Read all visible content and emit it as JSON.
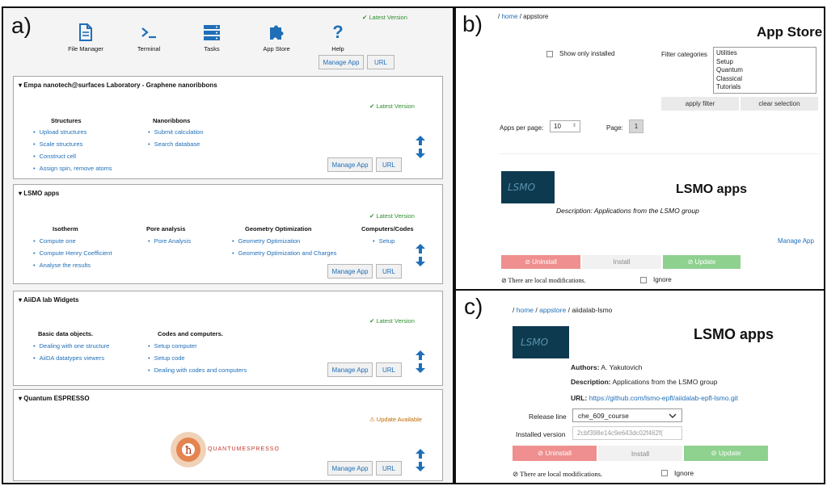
{
  "panel_a": {
    "label": "a)",
    "nav": [
      "File Manager",
      "Terminal",
      "Tasks",
      "App Store",
      "Help"
    ],
    "top_status": "✔ Latest Version",
    "top_buttons": [
      "Manage App",
      "URL"
    ],
    "apps": [
      {
        "title": "▾ Empa nanotech@surfaces Laboratory - Graphene nanoribbons",
        "status": "✔ Latest Version",
        "columns": [
          {
            "heading": "Structures",
            "items": [
              "Upload structures",
              "Scale structures",
              "Construct cell",
              "Assign spin, remove atoms"
            ]
          },
          {
            "heading": "Nanoribbons",
            "items": [
              "Submit calculation",
              "Search database"
            ]
          }
        ],
        "buttons": [
          "Manage App",
          "URL"
        ]
      },
      {
        "title": "▾ LSMO apps",
        "status": "✔ Latest Version",
        "columns": [
          {
            "heading": "Isotherm",
            "items": [
              "Compute one",
              "Compute Henry Coefficient",
              "Analyse the results"
            ]
          },
          {
            "heading": "Pore analysis",
            "items": [
              "Pore Analysis"
            ]
          },
          {
            "heading": "Geometry Optimization",
            "items": [
              "Geometry Optimization",
              "Geometry Optimization and Charges"
            ]
          },
          {
            "heading": "Computers/Codes",
            "items": [
              "Setup"
            ]
          }
        ],
        "buttons": [
          "Manage App",
          "URL"
        ]
      },
      {
        "title": "▾ AiiDA lab Widgets",
        "status": "✔ Latest Version",
        "columns": [
          {
            "heading": "Basic data objects.",
            "items": [
              "Dealing with one structure",
              "AiiDA datatypes viewers"
            ]
          },
          {
            "heading": "Codes and computers.",
            "items": [
              "Setup computer",
              "Setup code",
              "Dealing with codes and computers"
            ]
          }
        ],
        "buttons": [
          "Manage App",
          "URL"
        ]
      },
      {
        "title": "▾ Quantum ESPRESSO",
        "status": "⚠ Update Available",
        "logo_text": "QUANTUMESPRESSO",
        "buttons": [
          "Manage App",
          "URL"
        ]
      }
    ]
  },
  "panel_b": {
    "label": "b)",
    "breadcrumb": {
      "home": "home",
      "sep": "/",
      "current": "appstore"
    },
    "title": "App Store",
    "show_only_installed": "Show only installed",
    "filter_label": "Filter categories",
    "categories": [
      "Utilities",
      "Setup",
      "Quantum",
      "Classical",
      "Tutorials"
    ],
    "apply_filter": "apply filter",
    "clear_selection": "clear selection",
    "apps_per_page_label": "Apps per page:",
    "apps_per_page": "10",
    "page_label": "Page:",
    "page": "1",
    "logo_text": "LSMO",
    "app_title": "LSMO apps",
    "description": "Description: Applications from the LSMO group",
    "manage_app": "Manage App",
    "uninstall": "⊘ Uninstall",
    "install": "Install",
    "update": "⊘ Update",
    "local_mods": "⊘ There are local modifications.",
    "ignore": "Ignore"
  },
  "panel_c": {
    "label": "c)",
    "breadcrumb": {
      "home": "home",
      "appstore": "appstore",
      "current": "aiidalab-lsmo"
    },
    "logo_text": "LSMO",
    "title": "LSMO apps",
    "authors_label": "Authors:",
    "authors": "A. Yakutovich",
    "description_label": "Description:",
    "description": "Applications from the LSMO group",
    "url_label": "URL:",
    "url": "https://github.com/lsmo-epfl/aiidalab-epfl-lsmo.git",
    "release_line_label": "Release line",
    "release_line": "che_609_course",
    "installed_version_label": "Installed version",
    "installed_version": "2cbf398e14c9e643dc02f462f(",
    "uninstall": "⊘ Uninstall",
    "install": "Install",
    "update": "⊘ Update",
    "local_mods": "⊘ There are local modifications.",
    "ignore": "Ignore"
  },
  "colors": {
    "link": "#1f6fb8",
    "green": "#2f8f2f",
    "uninstall": "#ef8f8f",
    "update": "#8fd18f",
    "lsmo_logo": "#0e3a4f"
  }
}
